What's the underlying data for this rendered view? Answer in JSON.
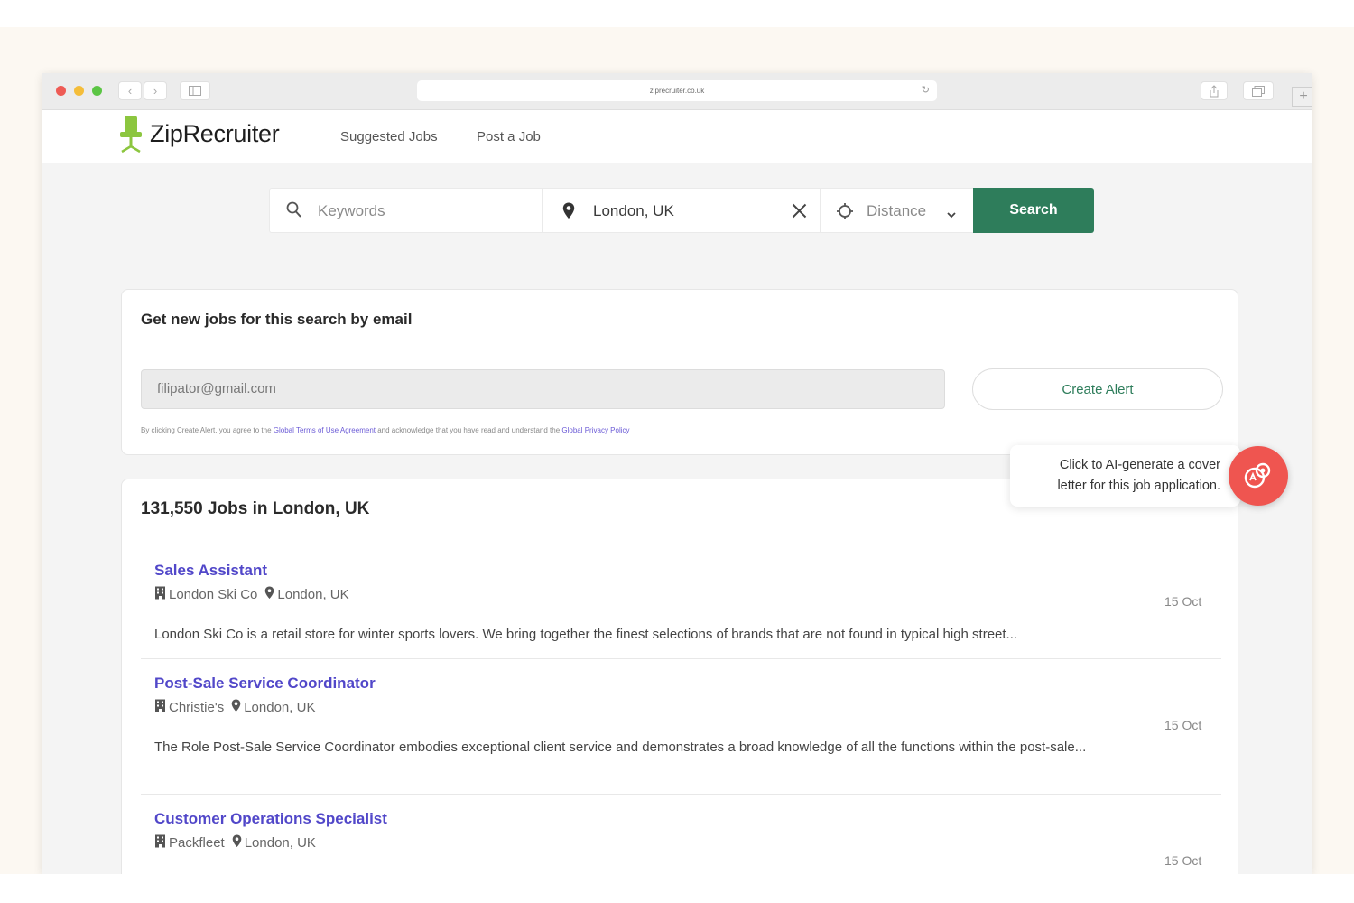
{
  "browser": {
    "url": "ziprecruiter.co.uk"
  },
  "header": {
    "logo_text": "ZipRecruiter",
    "nav": [
      "Suggested Jobs",
      "Post a Job"
    ]
  },
  "search": {
    "keywords_placeholder": "Keywords",
    "location_value": "London, UK",
    "distance_label": "Distance",
    "search_button": "Search"
  },
  "alert": {
    "title": "Get new jobs for this search by email",
    "email_value": "filipator@gmail.com",
    "create_button": "Create Alert",
    "legal_prefix": "By clicking Create Alert, you agree to the ",
    "legal_terms_link": "Global Terms of Use Agreement",
    "legal_middle": " and acknowledge that you have read and understand the ",
    "legal_privacy_link": "Global Privacy Policy"
  },
  "results": {
    "title": "131,550 Jobs in London, UK",
    "jobs": [
      {
        "title": "Sales Assistant",
        "company": "London Ski Co",
        "location": "London, UK",
        "description": "London Ski Co is a retail store for winter sports lovers. We bring together the finest selections of brands that are not found in typical high street...",
        "date": "15 Oct"
      },
      {
        "title": "Post-Sale Service Coordinator",
        "company": "Christie's",
        "location": "London, UK",
        "description": "The Role Post-Sale Service Coordinator embodies exceptional client service and demonstrates a broad knowledge of all the functions within the post-sale...",
        "date": "15 Oct"
      },
      {
        "title": "Customer Operations Specialist",
        "company": "Packfleet",
        "location": "London, UK",
        "description": "",
        "date": "15 Oct"
      }
    ]
  },
  "ai_tooltip": {
    "line1": "Click to AI-generate a cover",
    "line2": "letter for this job application."
  },
  "colors": {
    "brand_green": "#2e7d5b",
    "link_purple": "#5147c9",
    "ai_red": "#ef5550",
    "logo_green": "#8cc63f"
  }
}
